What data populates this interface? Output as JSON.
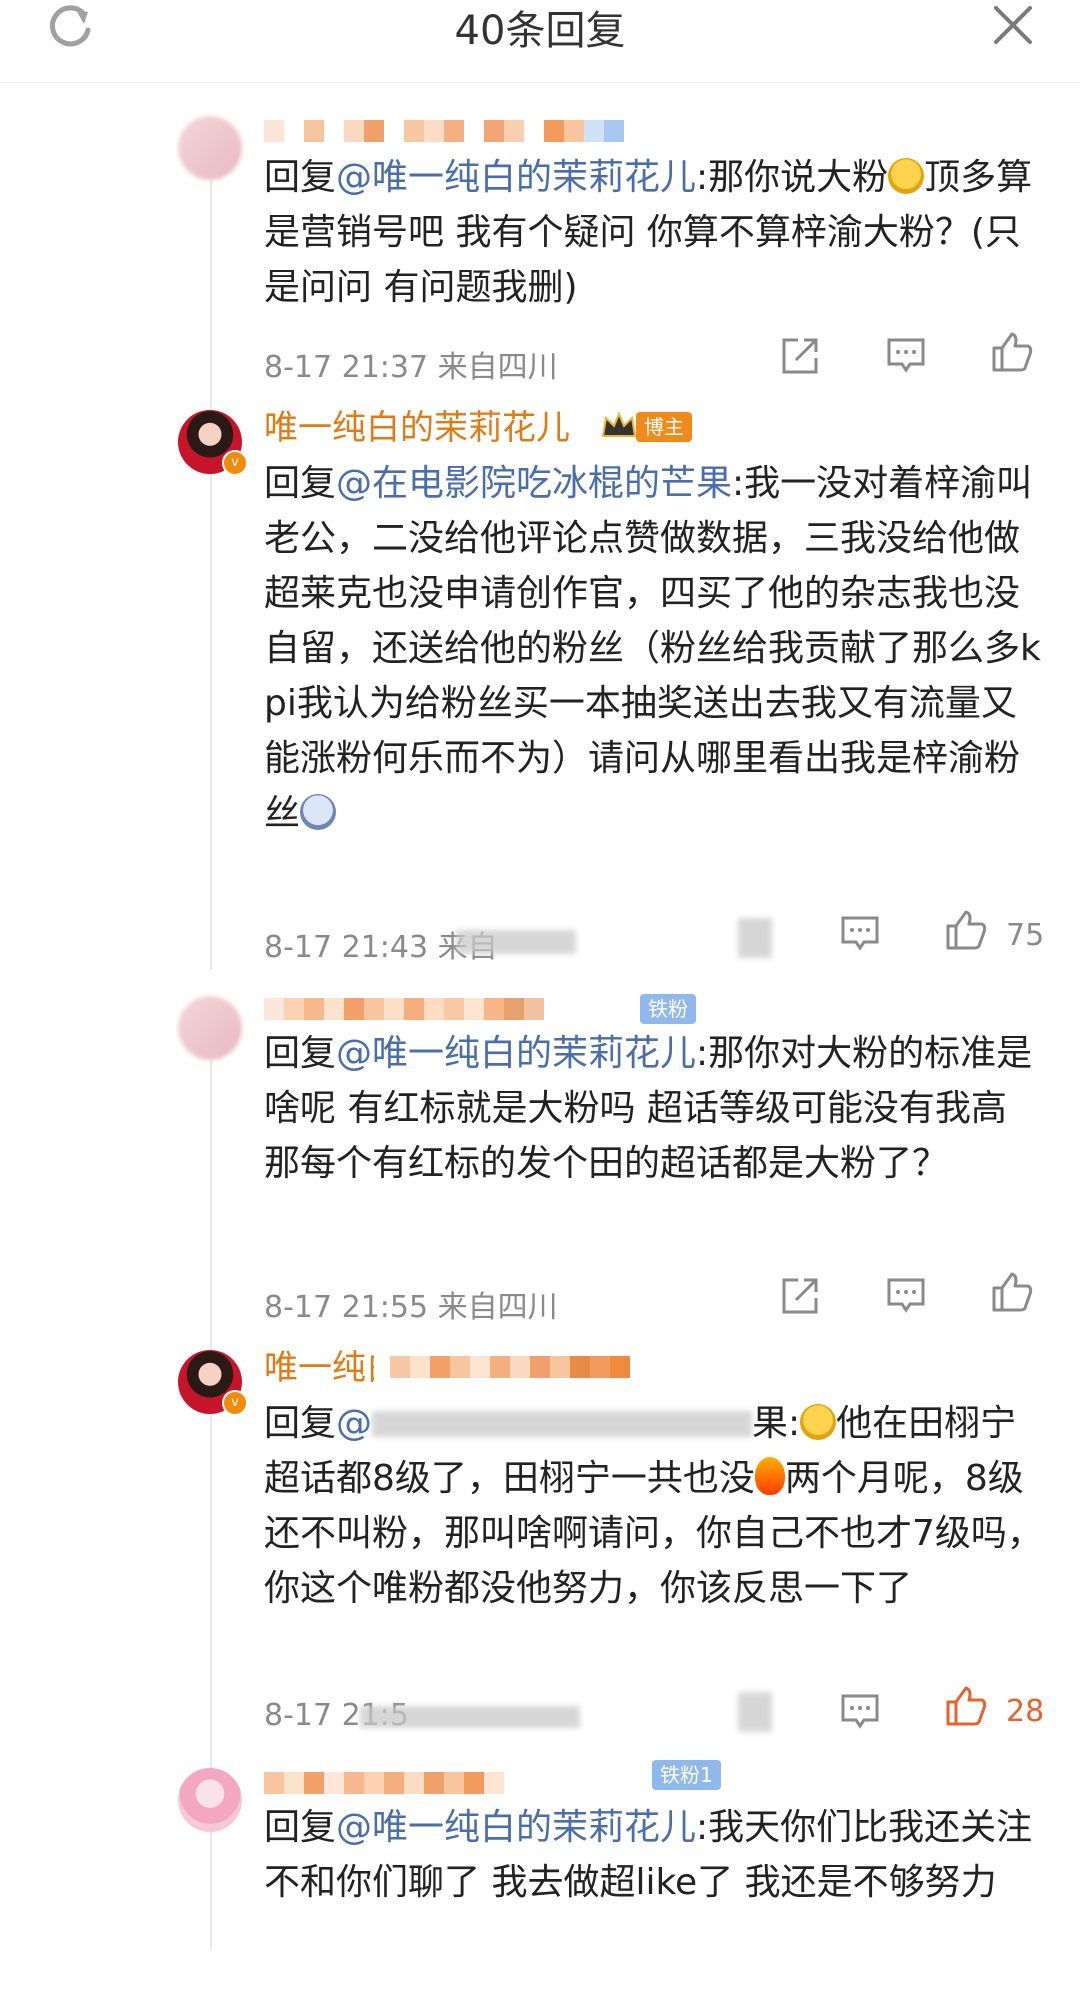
{
  "header": {
    "title": "40条回复"
  },
  "comments": [
    {
      "mention": "@唯一纯白的茉莉花儿",
      "text_a": "回复",
      "text_b": ":那你说大粉",
      "text_c": "顶多算是营销号吧 我有个疑问 你算不算梓渝大粉？(只是问问 有问题我删)",
      "time": "8-17 21:37 来自四川",
      "likes": ""
    },
    {
      "username": "唯一纯白的茉莉花儿",
      "tag": "博主",
      "mention": "@在电影院吃冰棍的芒果",
      "text_a": "回复",
      "text_b": ":我一没对着梓渝叫老公，二没给他评论点赞做数据，三我没给他做超莱克也没申请创作官，四买了他的杂志我也没自留，还送给他的粉丝（粉丝给我贡献了那么多kpi我认为给粉丝买一本抽奖送出去我又有流量又能涨粉何乐而不为）请问从哪里看出我是梓渝粉丝",
      "time": "8-17 21:43 来自",
      "likes": "75"
    },
    {
      "badge": "铁粉",
      "mention": "@唯一纯白的茉莉花儿",
      "text_a": "回复",
      "text_b": ":那你对大粉的标准是啥呢  有红标就是大粉吗  超话等级可能没有我高  那每个有红标的发个田的超话都是大粉了？",
      "time": "8-17 21:55 来自四川",
      "likes": ""
    },
    {
      "username": "唯一纯白的茉莉花儿",
      "mention": "@",
      "text_a": "回复",
      "text_b": "果:",
      "text_c": "他在田栩宁超话都8级了，田栩宁一共也没",
      "text_d": "两个月呢，8级还不叫粉，那叫啥啊请问，你自己不也才7级吗，你这个唯粉都没他努力，你该反思一下了",
      "time": "8-17 21:5",
      "likes": "28"
    },
    {
      "badge": "铁粉1",
      "mention": "@唯一纯白的茉莉花儿",
      "text_a": "回复",
      "text_b": ":我天你们比我还关注  不和你们聊了 我去做超like了 我还是不够努力",
      "time": "",
      "likes": ""
    }
  ],
  "colors": {
    "accent": "#e07a14",
    "mention": "#4a6ea9",
    "liked": "#e8622a"
  }
}
